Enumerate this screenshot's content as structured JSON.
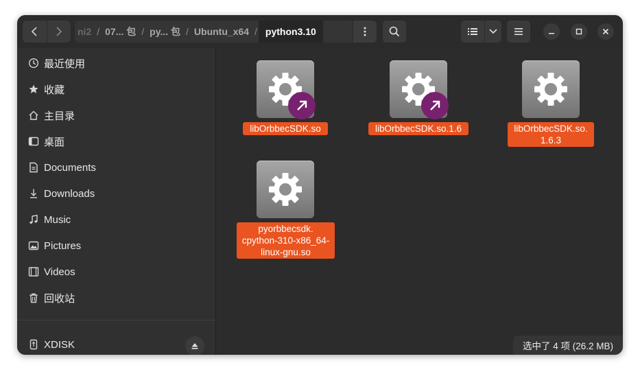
{
  "header": {
    "path": [
      {
        "label": "ni2"
      },
      {
        "label": "07... 包"
      },
      {
        "label": "py... 包"
      },
      {
        "label": "Ubuntu_x64"
      },
      {
        "label": "python3.10"
      }
    ],
    "separator": "/"
  },
  "sidebar": {
    "items": [
      {
        "label": "最近使用",
        "icon": "clock-icon"
      },
      {
        "label": "收藏",
        "icon": "star-icon"
      },
      {
        "label": "主目录",
        "icon": "home-icon"
      },
      {
        "label": "桌面",
        "icon": "desktop-icon"
      },
      {
        "label": "Documents",
        "icon": "document-icon"
      },
      {
        "label": "Downloads",
        "icon": "download-icon"
      },
      {
        "label": "Music",
        "icon": "music-icon"
      },
      {
        "label": "Pictures",
        "icon": "picture-icon"
      },
      {
        "label": "Videos",
        "icon": "video-icon"
      },
      {
        "label": "回收站",
        "icon": "trash-icon"
      }
    ],
    "devices": [
      {
        "label": "XDISK",
        "icon": "usb-drive-icon"
      }
    ]
  },
  "files": [
    {
      "name": "libOrbbecSDK.so",
      "symlink": true,
      "selected": true
    },
    {
      "name": "libOrbbecSDK.so.1.6",
      "symlink": true,
      "selected": true
    },
    {
      "name": "libOrbbecSDK.so.\n1.6.3",
      "symlink": false,
      "selected": true
    },
    {
      "name": "pyorbbecsdk.\ncpython-310-x86_64-\nlinux-gnu.so",
      "symlink": false,
      "selected": true
    }
  ],
  "status": {
    "text": "选中了 4 项 (26.2 MB)"
  },
  "colors": {
    "selection": "#e95420",
    "symlink_badge": "#77216f",
    "background": "#2c2c2c",
    "sidebar": "#303030"
  }
}
